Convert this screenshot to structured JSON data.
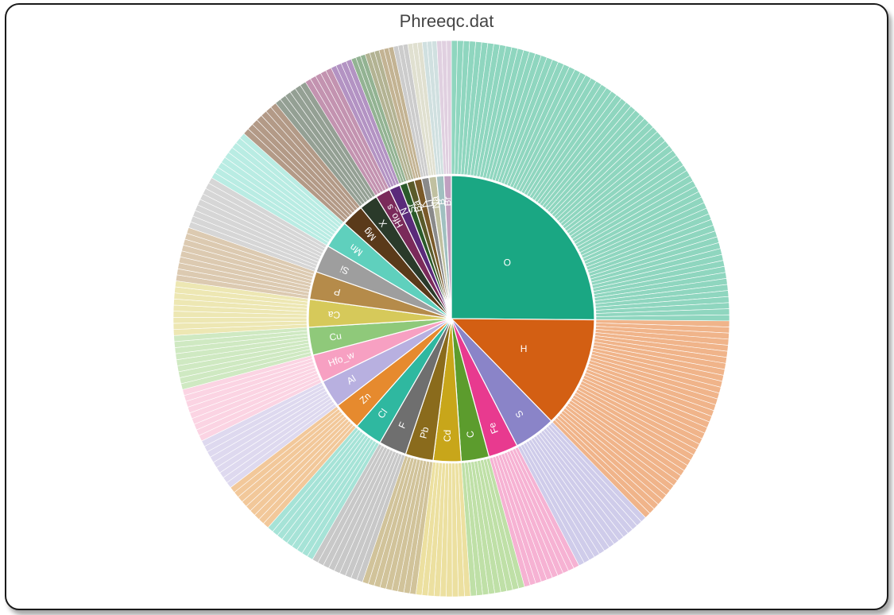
{
  "title": "Phreeqc.dat",
  "chart_data": {
    "type": "pie",
    "title": "Phreeqc.dat",
    "layout": "sunburst",
    "inner_ring_description": "element categories (fraction of total species)",
    "outer_ring_description": "many thin slices = individual species per element (values not labeled, equal-weight)",
    "categories": [
      "O",
      "H",
      "S",
      "Fe",
      "C",
      "Cd",
      "Pb",
      "F",
      "Cl",
      "Zn",
      "Al",
      "Hfo_w",
      "Cu",
      "Ca",
      "P",
      "Si",
      "Mn",
      "Mg",
      "X",
      "Hfo_s",
      "N",
      "Sr",
      "Ba",
      "K",
      "Li",
      "Na",
      "B",
      "Br"
    ],
    "values": [
      24,
      12,
      4.5,
      3.2,
      3.0,
      3.0,
      3.0,
      3.0,
      3.0,
      3.0,
      3.0,
      3.0,
      3.0,
      3.0,
      3.0,
      3.0,
      3.0,
      2.4,
      2.0,
      1.6,
      1.2,
      0.8,
      0.8,
      0.8,
      0.8,
      0.8,
      0.8,
      0.8
    ],
    "colors": [
      "#1aa783",
      "#d35f13",
      "#8a84c8",
      "#e83a8f",
      "#5c9c2d",
      "#c8a61a",
      "#8a6b1c",
      "#6f6f6f",
      "#2fb8a0",
      "#e68a2e",
      "#b8b0e0",
      "#f7a0c2",
      "#8fc97a",
      "#d6c95a",
      "#b58b4a",
      "#9e9e9e",
      "#5fd0bd",
      "#5a3a1a",
      "#2a3a2a",
      "#7a2a5a",
      "#5a2a7a",
      "#2a5a2a",
      "#5a5a2a",
      "#7a5a2a",
      "#8a8a8a",
      "#c0c0a0",
      "#a0c0c0",
      "#c0a0c0"
    ],
    "outer_colors": [
      "#8fd6bf",
      "#f0b48a",
      "#cfccea",
      "#f6b2d3",
      "#bfe0a7",
      "#ece0a0",
      "#d1c39a",
      "#c8c8c8",
      "#a6e3d7",
      "#f2c89a",
      "#ded9ef",
      "#fbd4e3",
      "#cfe9c2",
      "#ede7b3",
      "#dccab1",
      "#d6d6d6",
      "#b9ece3",
      "#b39a87",
      "#94a094",
      "#c393b0",
      "#b393c3",
      "#93b393",
      "#b3b393",
      "#c3b393",
      "#cccccc",
      "#e0e0d0",
      "#d0e0e0",
      "#e0d0e0"
    ],
    "outer_segments_per_category": [
      72,
      36,
      14,
      10,
      9,
      9,
      9,
      9,
      9,
      9,
      9,
      9,
      9,
      9,
      9,
      9,
      9,
      7,
      6,
      5,
      4,
      3,
      3,
      3,
      3,
      3,
      3,
      3
    ]
  }
}
